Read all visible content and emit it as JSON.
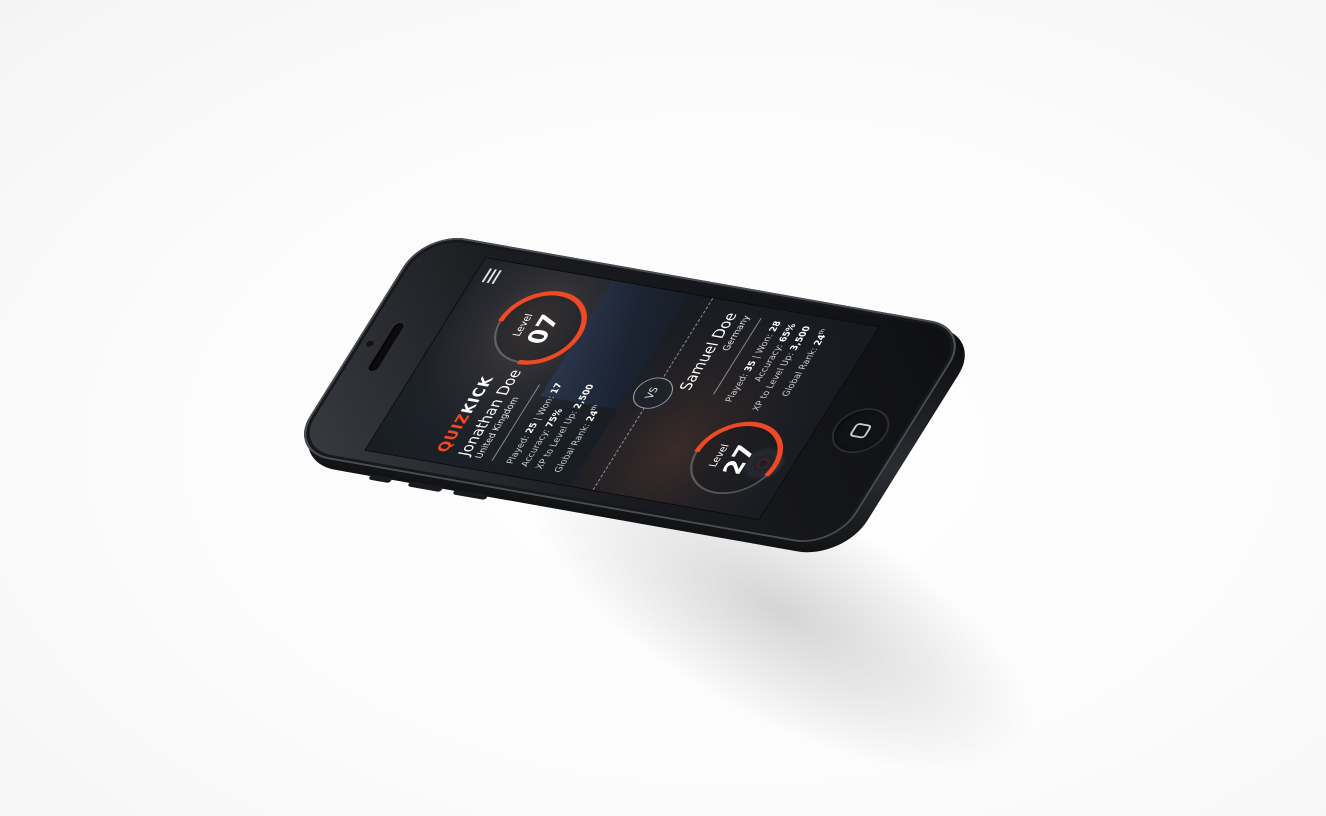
{
  "app": {
    "logo_part1": "QUIZ",
    "logo_part2": "KICK",
    "accent_color": "#f04a24"
  },
  "player1": {
    "name": "Jonathan Doe",
    "country": "United Kingdom",
    "played_label": "Played:",
    "played": "25",
    "won_label": "| Won:",
    "won": "17",
    "accuracy_label": "Accuracy:",
    "accuracy": "75%",
    "xp_label": "XP to Level Up:",
    "xp": "2,500",
    "rank_label": "Global Rank:",
    "rank": "24",
    "rank_suffix": "th",
    "level_label": "Level",
    "level": "07",
    "level_progress": 0.75
  },
  "versus": {
    "label": "VS"
  },
  "player2": {
    "name": "Samuel Doe",
    "country": "Germany",
    "played_label": "Played:",
    "played": "35",
    "won_label": "| Won:",
    "won": "28",
    "accuracy_label": "Accuracy:",
    "accuracy": "65%",
    "xp_label": "XP to Level Up:",
    "xp": "3,500",
    "rank_label": "Global Rank:",
    "rank": "24",
    "rank_suffix": "th",
    "level_label": "Level",
    "level": "27",
    "level_progress": 0.55
  },
  "icons": {
    "menu": "hamburger-menu-icon",
    "home": "home-button-icon"
  }
}
